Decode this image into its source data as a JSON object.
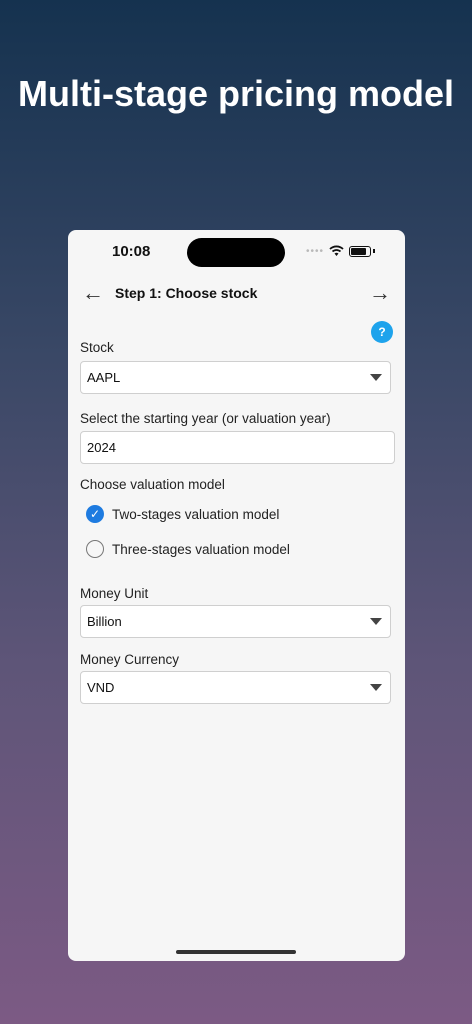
{
  "headline": "Multi-stage pricing model",
  "status_bar": {
    "time": "10:08",
    "dots": "••••",
    "wifi_icon": "wifi-icon",
    "battery_icon": "battery-icon"
  },
  "nav": {
    "back_icon": "←",
    "title": "Step 1: Choose stock",
    "next_icon": "→"
  },
  "help": {
    "label": "?"
  },
  "form": {
    "stock_label": "Stock",
    "stock_value": "AAPL",
    "year_label": "Select the starting year (or valuation year)",
    "year_value": "2024",
    "model_label": "Choose valuation model",
    "model_options": [
      {
        "label": "Two-stages valuation model",
        "selected": true
      },
      {
        "label": "Three-stages valuation model",
        "selected": false
      }
    ],
    "unit_label": "Money Unit",
    "unit_value": "Billion",
    "currency_label": "Money Currency",
    "currency_value": "VND"
  },
  "colors": {
    "accent": "#1e7be0",
    "help": "#1ea3ec"
  }
}
